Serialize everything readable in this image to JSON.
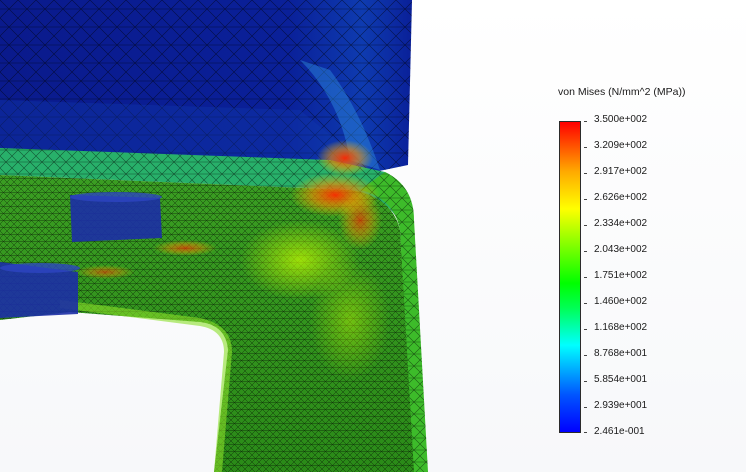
{
  "legend": {
    "title": "von Mises (N/mm^2 (MPa))",
    "ticks": [
      "3.500e+002",
      "3.209e+002",
      "2.917e+002",
      "2.626e+002",
      "2.334e+002",
      "2.043e+002",
      "1.751e+002",
      "1.460e+002",
      "1.168e+002",
      "8.768e+001",
      "5.854e+001",
      "2.939e+001",
      "2.461e-001"
    ],
    "colors": {
      "max": "#ff0000",
      "high": "#ffaa00",
      "mid": "#00ff00",
      "low": "#00ffff",
      "min": "#0000ff"
    }
  },
  "model": {
    "upper_part_color": "#0a1f99",
    "lower_part_color": "#2f9a1f",
    "hotspot_color": "#d83a1a",
    "bolt_color": "#1c2ea6"
  }
}
